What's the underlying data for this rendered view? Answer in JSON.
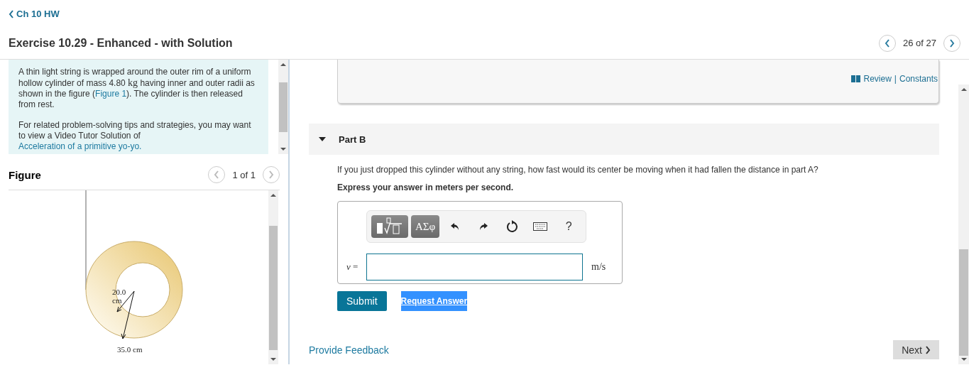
{
  "breadcrumb": {
    "label": "Ch 10 HW"
  },
  "title": "Exercise 10.29 - Enhanced - with Solution",
  "pager": {
    "text": "26 of 27"
  },
  "problem": {
    "paragraphs": [
      [
        {
          "kind": "text",
          "text": "A thin light string is wrapped around the outer rim of a uniform hollow cylinder of mass 4.80 "
        },
        {
          "kind": "math",
          "text": "kg"
        },
        {
          "kind": "text",
          "text": " having inner and outer radii as shown in the figure ("
        },
        {
          "kind": "link",
          "text": "Figure 1"
        },
        {
          "kind": "text",
          "text": "). The cylinder is then released from rest."
        }
      ],
      [
        {
          "kind": "text",
          "text": "For related problem-solving tips and strategies, you may want to view a Video Tutor Solution of "
        },
        {
          "kind": "link",
          "text": "Acceleration of a primitive yo-yo."
        }
      ]
    ]
  },
  "figure": {
    "title": "Figure",
    "pager": "1 of 1",
    "inner_label": "20.0 cm",
    "outer_label": "35.0 cm"
  },
  "resources": {
    "review": "Review",
    "separator": "|",
    "constants": "Constants"
  },
  "part": {
    "title": "Part B",
    "expanded": true,
    "question": "If you just dropped this cylinder without any string, how fast would its center be moving when it had fallen the distance in part A?",
    "instruction": "Express your answer in meters per second.",
    "toolbar": [
      {
        "kind": "template"
      },
      {
        "kind": "greek",
        "label": "ΑΣφ"
      },
      {
        "kind": "undo"
      },
      {
        "kind": "redo"
      },
      {
        "kind": "reset"
      },
      {
        "kind": "keyboard"
      },
      {
        "kind": "help",
        "label": "?"
      }
    ],
    "variable": "*v* =",
    "unit": "m/s",
    "buttons": [
      {
        "kind": "submit",
        "label": "Submit"
      },
      {
        "kind": "request",
        "label": "Request Answer"
      }
    ]
  },
  "feedback": "Provide Feedback",
  "next": "Next"
}
